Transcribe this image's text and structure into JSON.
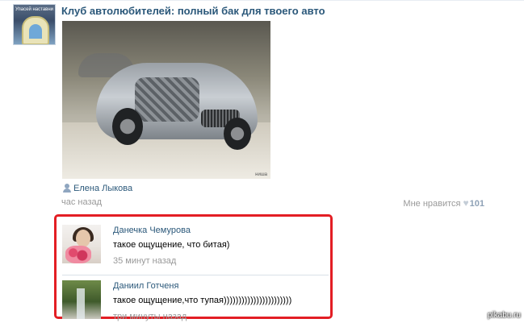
{
  "post": {
    "title": "Клуб автолюбителей: полный бак для твоего авто",
    "group_avatar_text": "Упасей наставник!",
    "photo_watermark": "ниша",
    "author": "Елена Лыкова",
    "time": "час назад",
    "likes_label": "Мне нравится",
    "likes_count": "101"
  },
  "comments": [
    {
      "name": "Данечка Чемурова",
      "text": "такое ощущение, что битая)",
      "time": "35 минут назад"
    },
    {
      "name": "Даниил Готченя",
      "text": "такое ощущение,что тупая)))))))))))))))))))))))",
      "time": "три минуты назад"
    }
  ],
  "watermark": "pikabu.ru",
  "colors": {
    "link": "#2b587a",
    "muted": "#999999",
    "highlight_border": "#e31e24"
  },
  "icons": {
    "author": "person-icon",
    "like": "heart-icon"
  }
}
